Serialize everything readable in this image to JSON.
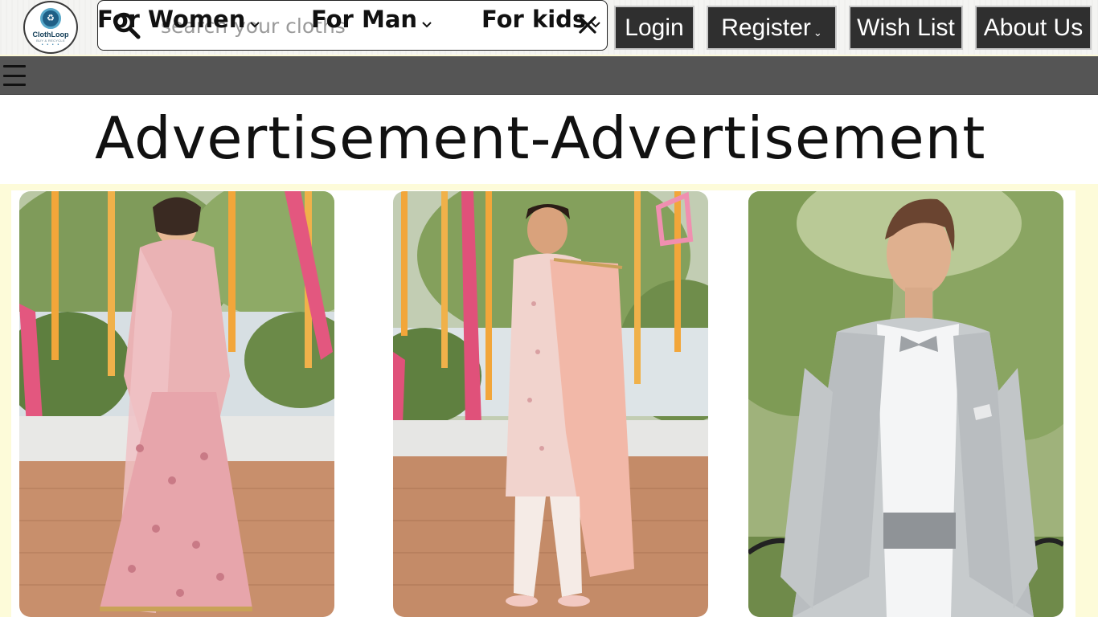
{
  "brand": {
    "name": "ClothLoop",
    "tagline": "BUY & RECYCLE"
  },
  "search": {
    "placeholder": "search your cloths",
    "value": ""
  },
  "header_buttons": {
    "login": "Login",
    "register": "Register",
    "wishlist": "Wish List",
    "about": "About Us"
  },
  "nav": {
    "items": [
      {
        "label": "For Women"
      },
      {
        "label": "For Man"
      },
      {
        "label": "For kids"
      }
    ]
  },
  "advertisement": {
    "text": "Advertisement-Advertisement"
  },
  "products": [
    {
      "image": "woman-pink-lehenga-photo"
    },
    {
      "image": "man-pink-sherwani-photo"
    },
    {
      "image": "man-grey-tuxedo-photo"
    }
  ],
  "colors": {
    "nav_bg": "#555555",
    "button_bg": "#2f2f2f",
    "cream": "#fdfbd9"
  }
}
